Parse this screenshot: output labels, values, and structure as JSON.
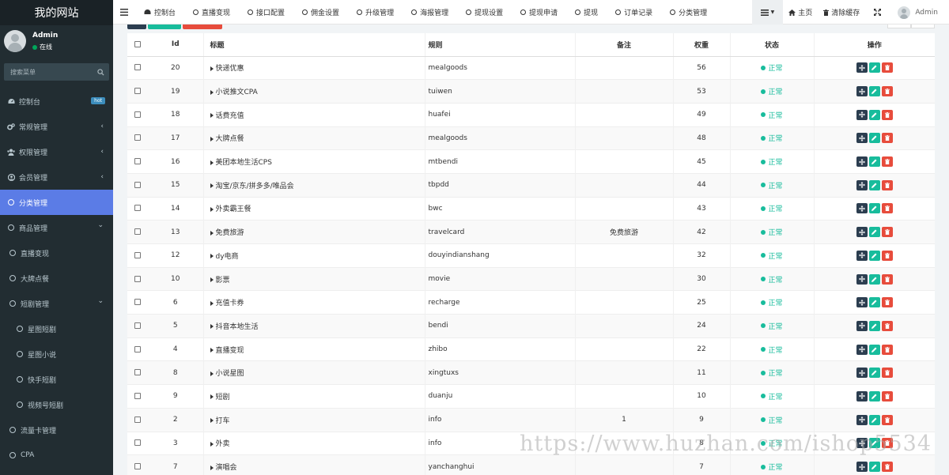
{
  "sidebar": {
    "brand": "我的网站",
    "user": {
      "name": "Admin",
      "status": "在线"
    },
    "search_placeholder": "搜索菜单",
    "items": [
      {
        "label": "控制台",
        "icon": "dashboard-icon",
        "badge": "hot"
      },
      {
        "label": "常规管理",
        "icon": "cogs-icon",
        "chevron": "‹"
      },
      {
        "label": "权限管理",
        "icon": "group-icon",
        "chevron": "‹"
      },
      {
        "label": "会员管理",
        "icon": "user-circle-icon",
        "chevron": "‹"
      },
      {
        "label": "分类管理",
        "icon": "circle-icon",
        "active": true
      },
      {
        "label": "商品管理",
        "icon": "circle-icon",
        "chevron": "⌄"
      },
      {
        "label": "直播变现",
        "icon": "circle-icon",
        "level": 1
      },
      {
        "label": "大牌点餐",
        "icon": "circle-icon",
        "level": 1
      },
      {
        "label": "短剧管理",
        "icon": "circle-icon",
        "level": 1,
        "chevron": "⌄"
      },
      {
        "label": "星图短剧",
        "icon": "circle-icon",
        "level": 2
      },
      {
        "label": "星图小说",
        "icon": "circle-icon",
        "level": 2
      },
      {
        "label": "快手短剧",
        "icon": "circle-icon",
        "level": 2
      },
      {
        "label": "视频号短剧",
        "icon": "circle-icon",
        "level": 2
      },
      {
        "label": "流量卡管理",
        "icon": "circle-icon",
        "level": 1
      },
      {
        "label": "CPA",
        "icon": "circle-icon",
        "level": 1
      }
    ]
  },
  "topnav": {
    "tabs": [
      {
        "label": "控制台",
        "icon": "dashboard-icon"
      },
      {
        "label": "直播变现",
        "icon": "circle-icon"
      },
      {
        "label": "接口配置",
        "icon": "circle-icon"
      },
      {
        "label": "佣金设置",
        "icon": "circle-icon"
      },
      {
        "label": "升级管理",
        "icon": "circle-icon"
      },
      {
        "label": "海报管理",
        "icon": "circle-icon"
      },
      {
        "label": "提现设置",
        "icon": "circle-icon"
      },
      {
        "label": "提现申请",
        "icon": "circle-icon"
      },
      {
        "label": "提现",
        "icon": "circle-icon"
      },
      {
        "label": "订单记录",
        "icon": "circle-icon"
      },
      {
        "label": "分类管理",
        "icon": "circle-icon"
      }
    ],
    "right": {
      "home_label": "主页",
      "clear_cache_label": "清除缓存",
      "user_label": "Admin"
    }
  },
  "table": {
    "headers": {
      "id": "Id",
      "title": "标题",
      "rule": "规则",
      "note": "备注",
      "weight": "权重",
      "status": "状态",
      "ops": "操作"
    },
    "rows": [
      {
        "id": "20",
        "title": "快递优惠",
        "rule": "mealgoods",
        "note": "",
        "weight": "56",
        "status": "正常"
      },
      {
        "id": "19",
        "title": "小说推文CPA",
        "rule": "tuiwen",
        "note": "",
        "weight": "53",
        "status": "正常"
      },
      {
        "id": "18",
        "title": "话费充值",
        "rule": "huafei",
        "note": "",
        "weight": "49",
        "status": "正常"
      },
      {
        "id": "17",
        "title": "大牌点餐",
        "rule": "mealgoods",
        "note": "",
        "weight": "48",
        "status": "正常"
      },
      {
        "id": "16",
        "title": "美团本地生活CPS",
        "rule": "mtbendi",
        "note": "",
        "weight": "45",
        "status": "正常"
      },
      {
        "id": "15",
        "title": "淘宝/京东/拼多多/唯品会",
        "rule": "tbpdd",
        "note": "",
        "weight": "44",
        "status": "正常"
      },
      {
        "id": "14",
        "title": "外卖霸王餐",
        "rule": "bwc",
        "note": "",
        "weight": "43",
        "status": "正常"
      },
      {
        "id": "13",
        "title": "免费旅游",
        "rule": "travelcard",
        "note": "免费旅游",
        "weight": "42",
        "status": "正常"
      },
      {
        "id": "12",
        "title": "dy电商",
        "rule": "douyindianshang",
        "note": "",
        "weight": "32",
        "status": "正常"
      },
      {
        "id": "10",
        "title": "影票",
        "rule": "movie",
        "note": "",
        "weight": "30",
        "status": "正常"
      },
      {
        "id": "6",
        "title": "充值卡券",
        "rule": "recharge",
        "note": "",
        "weight": "25",
        "status": "正常"
      },
      {
        "id": "5",
        "title": "抖音本地生活",
        "rule": "bendi",
        "note": "",
        "weight": "24",
        "status": "正常"
      },
      {
        "id": "4",
        "title": "直播变现",
        "rule": "zhibo",
        "note": "",
        "weight": "22",
        "status": "正常"
      },
      {
        "id": "8",
        "title": "小说星图",
        "rule": "xingtuxs",
        "note": "",
        "weight": "11",
        "status": "正常"
      },
      {
        "id": "9",
        "title": "短剧",
        "rule": "duanju",
        "note": "",
        "weight": "10",
        "status": "正常"
      },
      {
        "id": "2",
        "title": "打车",
        "rule": "info",
        "note": "1",
        "weight": "9",
        "status": "正常"
      },
      {
        "id": "3",
        "title": "外卖",
        "rule": "info",
        "note": "",
        "weight": "8",
        "status": "正常"
      },
      {
        "id": "7",
        "title": "演唱会",
        "rule": "yanchanghui",
        "note": "",
        "weight": "7",
        "status": "正常"
      }
    ]
  },
  "watermark": "https://www.huzhan.com/ishop5534",
  "colors": {
    "sidebar_bg": "#222d32",
    "active_item": "#5b7ce6",
    "status_green": "#18bc9c",
    "btn_move": "#2c3e50",
    "btn_edit": "#18bc9c",
    "btn_delete": "#e74c3c"
  }
}
